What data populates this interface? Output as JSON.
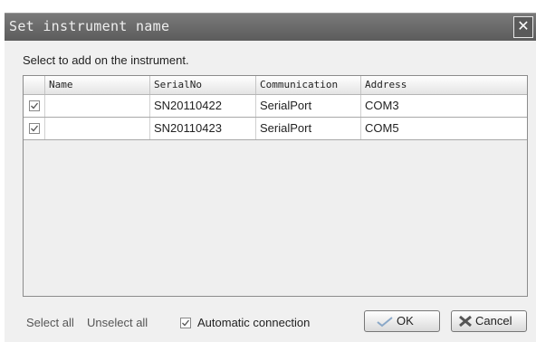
{
  "window": {
    "title": "Set instrument name",
    "close_glyph": "✕"
  },
  "prompt": "Select to add on the instrument.",
  "grid": {
    "columns": [
      "Name",
      "SerialNo",
      "Communication",
      "Address"
    ],
    "rows": [
      {
        "checked": true,
        "name": "",
        "serial": "SN20110422",
        "communication": "SerialPort",
        "address": "COM3"
      },
      {
        "checked": true,
        "name": "",
        "serial": "SN20110423",
        "communication": "SerialPort",
        "address": "COM5"
      }
    ]
  },
  "footer": {
    "select_all": "Select all",
    "unselect_all": "Unselect all",
    "auto_connection_checked": true,
    "auto_connection_label": "Automatic connection",
    "ok_label": "OK",
    "ok_icon": "checkmark-icon",
    "cancel_label": "Cancel",
    "cancel_icon": "cross-icon"
  },
  "colors": {
    "titlebar": "#6b6b6b",
    "dialog_bg": "#f0f0f0",
    "row_bg": "#ffffff",
    "ok_check": "#8aa8c8",
    "cancel_cross": "#555555"
  }
}
